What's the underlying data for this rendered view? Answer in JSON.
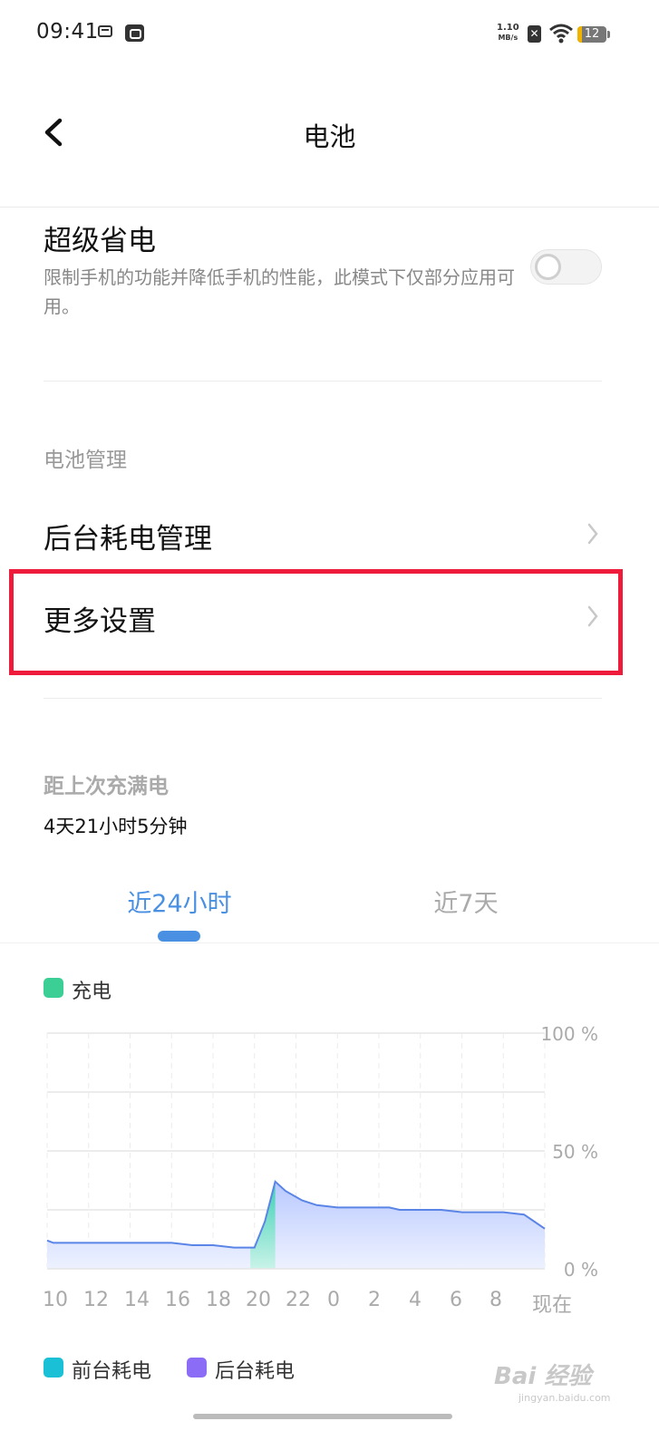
{
  "status_bar": {
    "time": "09:41",
    "net_speed_value": "1.10",
    "net_speed_unit": "MB/s",
    "battery_level": "12"
  },
  "header": {
    "title": "电池"
  },
  "super_saving": {
    "title": "超级省电",
    "description": "限制手机的功能并降低手机的性能，此模式下仅部分应用可用。",
    "enabled": false
  },
  "battery_management": {
    "section_label": "电池管理",
    "items": [
      {
        "label": "后台耗电管理"
      },
      {
        "label": "更多设置"
      }
    ]
  },
  "since_full": {
    "label": "距上次充满电",
    "value": "4天21小时5分钟"
  },
  "tabs": [
    {
      "label": "近24小时",
      "selected": true
    },
    {
      "label": "近7天",
      "selected": false
    }
  ],
  "legend_top": {
    "label": "充电",
    "color": "#3ccf95"
  },
  "legend_bottom": [
    {
      "label": "前台耗电",
      "color": "#19c0d6"
    },
    {
      "label": "后台耗电",
      "color": "#8b6cf7"
    }
  ],
  "chart_data": {
    "type": "area",
    "x_tick_labels": [
      "10",
      "12",
      "14",
      "16",
      "18",
      "20",
      "22",
      "0",
      "2",
      "4",
      "6",
      "8",
      "现在"
    ],
    "y_tick_labels": [
      "100 %",
      "50 %",
      "0 %"
    ],
    "ylim": [
      0,
      100
    ],
    "series": [
      {
        "name": "battery_level",
        "x_hours_since_start": [
          0,
          0.3,
          2,
          4,
          5.5,
          6,
          7,
          8,
          9,
          9.8,
          10,
          10.5,
          11,
          11.5,
          12.3,
          13,
          14,
          15,
          16,
          16.5,
          17,
          18,
          19,
          20,
          21,
          22,
          23,
          23.5,
          24
        ],
        "y": [
          12,
          11,
          11,
          11,
          11,
          11,
          10,
          10,
          9,
          9,
          9,
          20,
          37,
          33,
          29,
          27,
          26,
          26,
          26,
          26,
          25,
          25,
          25,
          24,
          24,
          24,
          23,
          20,
          17
        ]
      }
    ],
    "charging_interval_hours": [
      9.8,
      11
    ],
    "grid": true,
    "area_fill": "#d6e0ff",
    "line_color": "#5a84e6",
    "charge_fill": "#3ccfb5"
  }
}
